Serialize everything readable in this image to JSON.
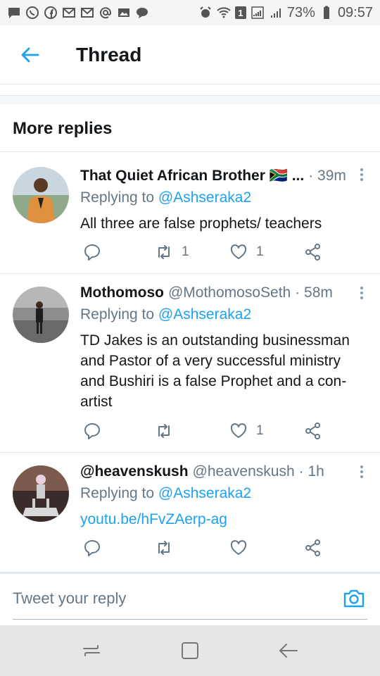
{
  "status_bar": {
    "battery": "73%",
    "time": "09:57",
    "sim_badge": "1"
  },
  "header": {
    "title": "Thread"
  },
  "section": {
    "title": "More replies"
  },
  "tweets": [
    {
      "name": "That Quiet African Brother 🇿🇦 ...",
      "handle": "",
      "time": "· 39m",
      "replying_prefix": "Replying to",
      "replying_to": "@Ashseraka2",
      "text": "All three are false prophets/ teachers",
      "link": "",
      "retweets": "1",
      "likes": "1"
    },
    {
      "name": "Mothomoso",
      "handle": "@MothomosoSeth",
      "time": "· 58m",
      "replying_prefix": "Replying to",
      "replying_to": "@Ashseraka2",
      "text": "TD Jakes is an outstanding businessman and Pastor of a very successful ministry and Bushiri is a false Prophet and a con-artist",
      "link": "",
      "retweets": "",
      "likes": "1"
    },
    {
      "name": "@heavenskush",
      "handle": "@heavenskush",
      "time": "· 1h",
      "replying_prefix": "Replying to",
      "replying_to": "@Ashseraka2",
      "text": "",
      "link": "youtu.be/hFvZAerp-ag",
      "retweets": "",
      "likes": ""
    }
  ],
  "reply_bar": {
    "placeholder": "Tweet your reply"
  },
  "colors": {
    "accent": "#1da1f2",
    "muted": "#657786",
    "text": "#14171a"
  }
}
